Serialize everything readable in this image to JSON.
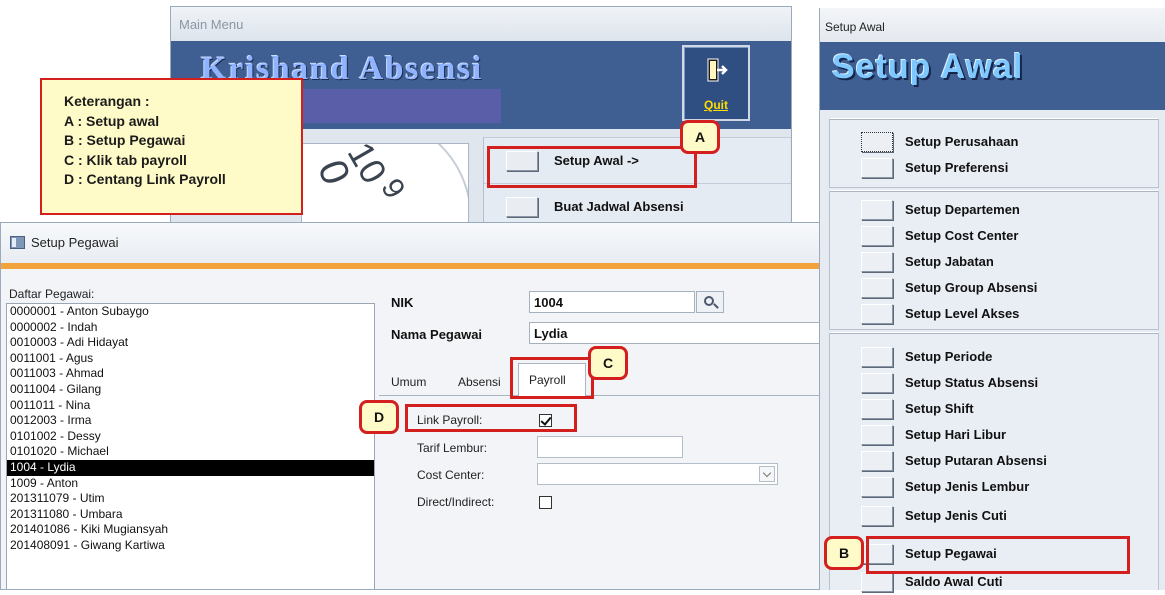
{
  "main_menu": {
    "window_title": "Main Menu",
    "app_title": "Krishand Absensi",
    "quit_label": "Quit",
    "clock_digits": [
      "0",
      "10",
      "9"
    ],
    "items": [
      {
        "label": "Setup Awal ->"
      },
      {
        "label": "Buat Jadwal Absensi"
      }
    ]
  },
  "keterangan": {
    "title": "Keterangan :",
    "lines": [
      "A : Setup awal",
      "B : Setup Pegawai",
      "C : Klik tab payroll",
      "D : Centang Link Payroll"
    ]
  },
  "setup_awal": {
    "window_title": "Setup Awal",
    "banner_title": "Setup Awal",
    "groups": [
      {
        "items": [
          "Setup Perusahaan",
          "Setup Preferensi"
        ]
      },
      {
        "items": [
          "Setup Departemen",
          "Setup Cost Center",
          "Setup Jabatan",
          "Setup Group Absensi",
          "Setup Level Akses"
        ]
      },
      {
        "items": [
          "Setup Periode",
          "Setup Status Absensi",
          "Setup Shift",
          "Setup Hari Libur",
          "Setup Putaran Absensi",
          "Setup Jenis Lembur",
          "Setup Jenis Cuti",
          "Setup Pegawai",
          "Saldo Awal Cuti"
        ]
      }
    ]
  },
  "setup_pegawai": {
    "window_title": "Setup Pegawai",
    "list_label": "Daftar Pegawai:",
    "employees": [
      "0000001 - Anton Subaygo",
      "0000002 - Indah",
      "0010003 - Adi Hidayat",
      "0011001 - Agus",
      "0011003 - Ahmad",
      "0011004 - Gilang",
      "0011011 - Nina",
      "0012003 - Irma",
      "0101002 - Dessy",
      "0101020 - Michael",
      "1004 - Lydia",
      "1009 - Anton",
      "201311079 - Utim",
      "201311080 - Umbara",
      "201401086 - Kiki Mugiansyah",
      "201408091 - Giwang Kartiwa"
    ],
    "selected_index": 10,
    "nik_label": "NIK",
    "nik_value": "1004",
    "nama_label": "Nama Pegawai",
    "nama_value": "Lydia",
    "tabs": [
      "Umum",
      "Absensi",
      "Payroll"
    ],
    "active_tab": "Payroll",
    "payroll": {
      "link_payroll_label": "Link Payroll:",
      "link_payroll_checked": true,
      "tarif_lembur_label": "Tarif Lembur:",
      "tarif_lembur_value": "",
      "cost_center_label": "Cost Center:",
      "cost_center_value": "",
      "direct_indirect_label": "Direct/Indirect:",
      "direct_indirect_checked": false
    }
  },
  "callouts": {
    "A": "A",
    "B": "B",
    "C": "C",
    "D": "D"
  },
  "colors": {
    "accent_red": "#d41f1f",
    "note_yellow": "#fffbc8",
    "banner_blue": "#3f5f93",
    "separator_orange": "#f2a23a"
  }
}
